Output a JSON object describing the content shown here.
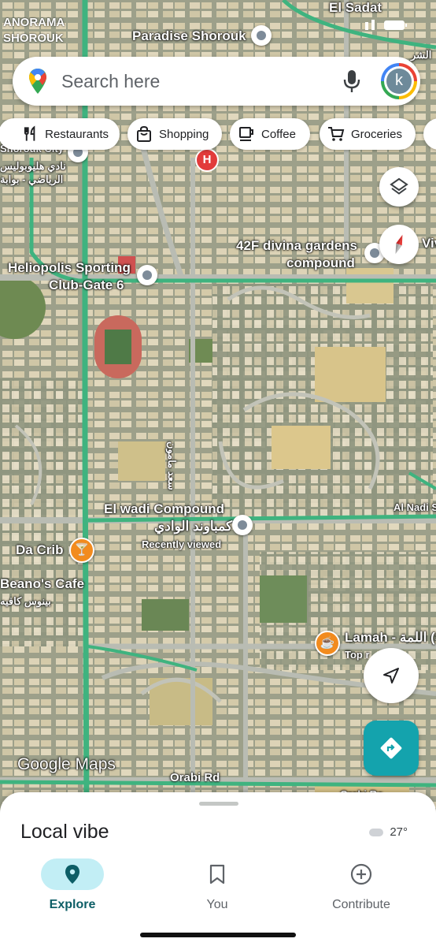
{
  "status_bar": {
    "left_text": "ANORAMA",
    "left_text_2": "SHOROUK"
  },
  "map": {
    "labels": {
      "el_sadat": "El Sadat",
      "paradise": "Paradise Shorouk",
      "shorouk_city": "Shorouk City",
      "arabic_heliopolis": "نادي هليوبوليس",
      "arabic_heliopolis_2": "الرياضي - بوابة",
      "heliopolis": "Heliopolis Sporting",
      "heliopolis_2": "Club-Gate 6",
      "divina": "42F divina gardens",
      "divina_2": "compound",
      "viv": "Viv",
      "arabic_street": "سعد مامون",
      "elwadi": "El wadi Compound",
      "elwadi_ar": "كمباوند الوادي",
      "recently": "Recently viewed",
      "al_nadi": "Al Nadi S",
      "da_crib": "Da Crib",
      "beanos": "Beano's Cafe",
      "beanos_ar": "بينوس كافيه",
      "lamah": "Lamah - اللمة (Sh",
      "top_rated": "Top r",
      "orabi": "Orabi Rd",
      "orabi_2": "Orabi Ro",
      "watermark": "Google Maps",
      "arabic_top_right": "الشر"
    }
  },
  "search": {
    "placeholder": "Search here",
    "avatar_letter": "k"
  },
  "chips": [
    {
      "label": "Restaurants",
      "icon": "fork-knife-icon"
    },
    {
      "label": "Shopping",
      "icon": "shopping-bag-icon"
    },
    {
      "label": "Coffee",
      "icon": "coffee-cup-icon"
    },
    {
      "label": "Groceries",
      "icon": "cart-icon"
    }
  ],
  "pins": {
    "hospital_letter": "H"
  },
  "sheet": {
    "title": "Local vibe",
    "temperature": "27°"
  },
  "nav": {
    "explore": "Explore",
    "you": "You",
    "contribute": "Contribute"
  },
  "colors": {
    "accent": "#137b86",
    "explore_pill": "#c2eef5",
    "directions": "#14a3ad",
    "road_green": "#3fb37f"
  }
}
